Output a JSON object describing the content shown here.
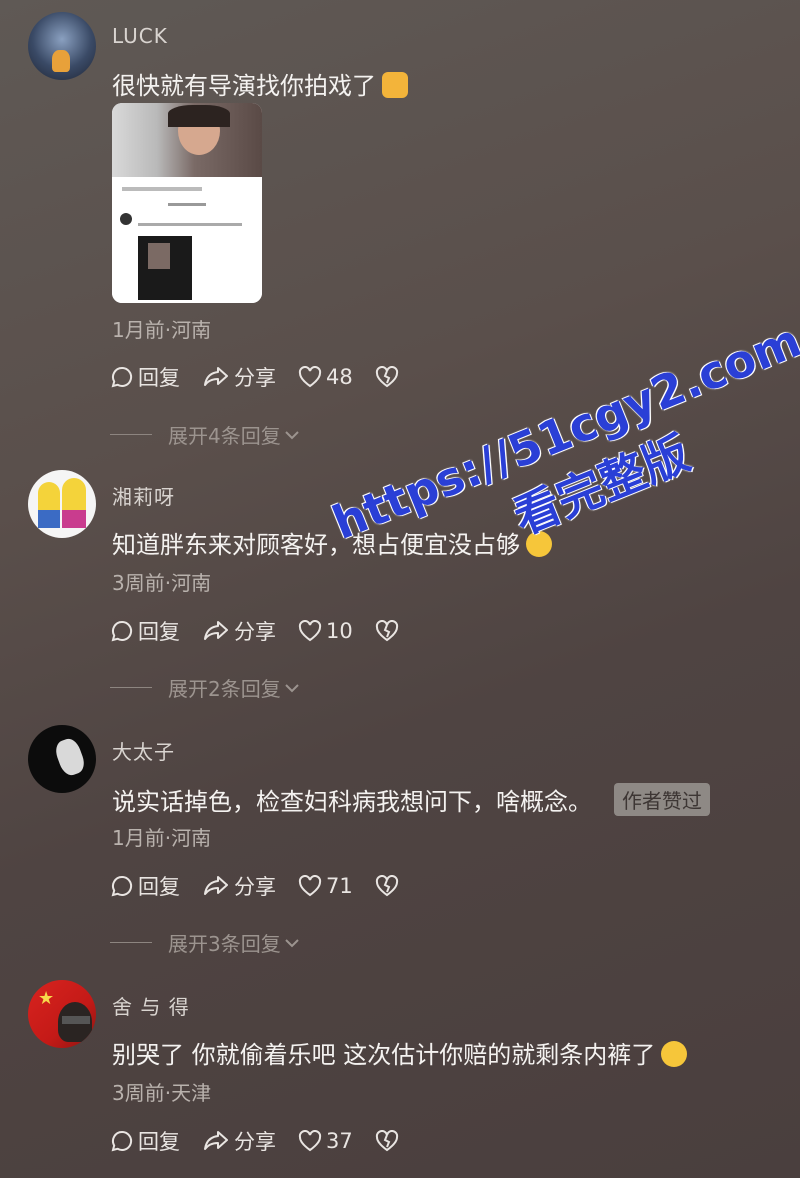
{
  "comments": [
    {
      "username": "LUCK",
      "text": "很快就有导演找你拍戏了",
      "meta": "1月前·河南",
      "reply_label": "回复",
      "share_label": "分享",
      "likes": "48",
      "expand_label": "展开4条回复",
      "emoji": "thumbs-up-emoji",
      "has_image": true
    },
    {
      "username": "湘莉呀",
      "text": "知道胖东来对顾客好，想占便宜没占够",
      "meta": "3周前·河南",
      "reply_label": "回复",
      "share_label": "分享",
      "likes": "10",
      "expand_label": "展开2条回复",
      "emoji": "laughing-crying-emoji"
    },
    {
      "username": "大太子",
      "text": "说实话掉色，检查妇科病我想问下，啥概念。",
      "badge": "作者赞过",
      "meta": "1月前·河南",
      "reply_label": "回复",
      "share_label": "分享",
      "likes": "71",
      "expand_label": "展开3条回复"
    },
    {
      "username": "舍 与 得",
      "text": "别哭了 你就偷着乐吧 这次估计你赔的就剩条内裤了",
      "meta": "3周前·天津",
      "reply_label": "回复",
      "share_label": "分享",
      "likes": "37",
      "emoji": "laughing-crying-emoji"
    }
  ],
  "watermark": {
    "url": "https://51cgy2.com",
    "subtitle": "看完整版"
  },
  "colors": {
    "background": "#5a4f4b",
    "watermark": "#2a3fd6",
    "badge_bg": "#8e8985"
  }
}
